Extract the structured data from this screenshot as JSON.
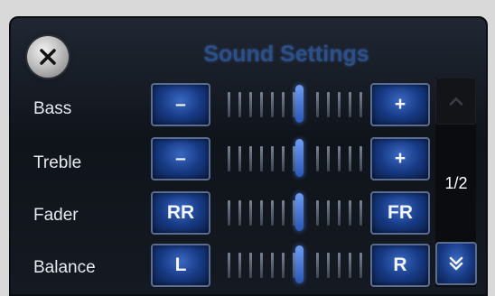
{
  "header": {
    "title": "Sound Settings"
  },
  "rows": [
    {
      "label": "Bass",
      "left_button": "–",
      "right_button": "+"
    },
    {
      "label": "Treble",
      "left_button": "–",
      "right_button": "+"
    },
    {
      "label": "Fader",
      "left_button": "RR",
      "right_button": "FR"
    },
    {
      "label": "Balance",
      "left_button": "L",
      "right_button": "R"
    }
  ],
  "pager": {
    "indicator": "1/2"
  },
  "icons": {
    "close": "close-icon",
    "page_up": "chevron-up-icon",
    "page_down": "double-chevron-down-icon"
  },
  "colors": {
    "title": "#2c4f88",
    "button": "#173a85",
    "slider_knob": "#4f7fe0"
  }
}
